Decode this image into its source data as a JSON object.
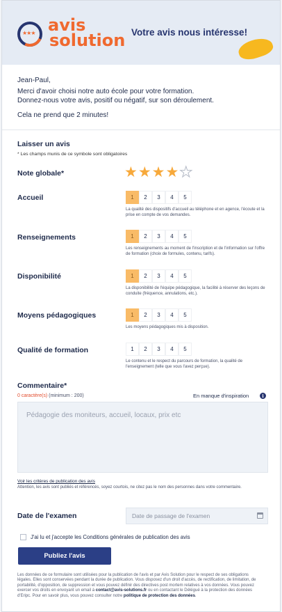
{
  "header": {
    "brand_line1": "avis",
    "brand_line2": "solution",
    "logo_stars": "★★★",
    "tagline": "Votre avis nous intéresse!"
  },
  "intro": {
    "greeting": "Jean-Paul,",
    "line1": "Merci d'avoir choisi notre auto école pour votre formation.",
    "line2": "Donnez-nous votre avis, positif ou négatif, sur son déroulement.",
    "line3": "Cela ne prend que 2 minutes!"
  },
  "form": {
    "title": "Laisser un avis",
    "required_note": "* Les champs munis de ce symbole sont obligatoires",
    "overall": {
      "label": "Note globale*",
      "rating": 4,
      "max": 5
    },
    "criteria": [
      {
        "label": "Accueil",
        "selected": 1,
        "options": [
          "1",
          "2",
          "3",
          "4",
          "5"
        ],
        "description": "La qualité des dispositifs d'accueil au téléphone et en agence, l'écoute et la prise en compte de vos demandes."
      },
      {
        "label": "Renseignements",
        "selected": 1,
        "options": [
          "1",
          "2",
          "3",
          "4",
          "5"
        ],
        "description": "Les renseignements au moment de l'inscription et de l'information sur l'offre de formation (choix de formules, contenu, tarifs)."
      },
      {
        "label": "Disponibilité",
        "selected": 1,
        "options": [
          "1",
          "2",
          "3",
          "4",
          "5"
        ],
        "description": "La disponibilité de l'équipe pédagogique, la facilité à réserver des leçons de conduite (fréquence, annulations, etc.)."
      },
      {
        "label": "Moyens pédagogiques",
        "selected": 1,
        "options": [
          "1",
          "2",
          "3",
          "4",
          "5"
        ],
        "description": "Les moyens pédagogiques mis à disposition."
      },
      {
        "label": "Qualité de formation",
        "selected": 0,
        "options": [
          "1",
          "2",
          "3",
          "4",
          "5"
        ],
        "description": "Le contenu et le respect du parcours de formation, la qualité de l'enseignement (telle que vous l'avez perçue)."
      }
    ],
    "comment": {
      "label": "Commentaire*",
      "count_value": "0 caractère(s)",
      "count_min": "(minimum : 200)",
      "inspiration": "En manque d'inspiration",
      "info_glyph": "i",
      "placeholder": "Pédagogie des moniteurs, accueil, locaux, prix etc"
    },
    "criteria_link": "Voir les critères de publication des avis",
    "attention": "Attention, les avis sont publiés et référencés, soyez courtois, ne citez pas le nom des personnes dans votre commentaire.",
    "exam_date": {
      "label": "Date de l'examen",
      "placeholder": "Date de passage de l'examen"
    },
    "terms": {
      "prefix": "J'ai lu et j'accepte les",
      "link": "Conditions générales de publication des avis"
    },
    "submit_label": "Publiez l'avis",
    "legal": {
      "text1": "Les données de ce formulaire sont utilisées pour la publication de l'avis et par Avis Solution pour le respect de ses obligations légales. Elles sont conservées pendant la durée de publication. Vous disposez d'un droit d'accès, de rectification, de limitation, de portabilité, d'opposition, de suppression et vous pouvez définir des directives post mortem relatives à vos données. Vous pouvez exercer vos droits en envoyant un email à",
      "email": "contact@avis-solutions.fr",
      "text2": "ou en contactant le Délégué à la protection des données d'Eripc. Pour en savoir plus, vous pouvez consulter notre",
      "policy_link": "politique de protection des données",
      "end": "."
    }
  },
  "colors": {
    "accent_orange": "#f0692f",
    "navy": "#27356f",
    "star": "#f7a93b",
    "selected_scale": "#f9bb67",
    "button": "#2b3f86"
  }
}
